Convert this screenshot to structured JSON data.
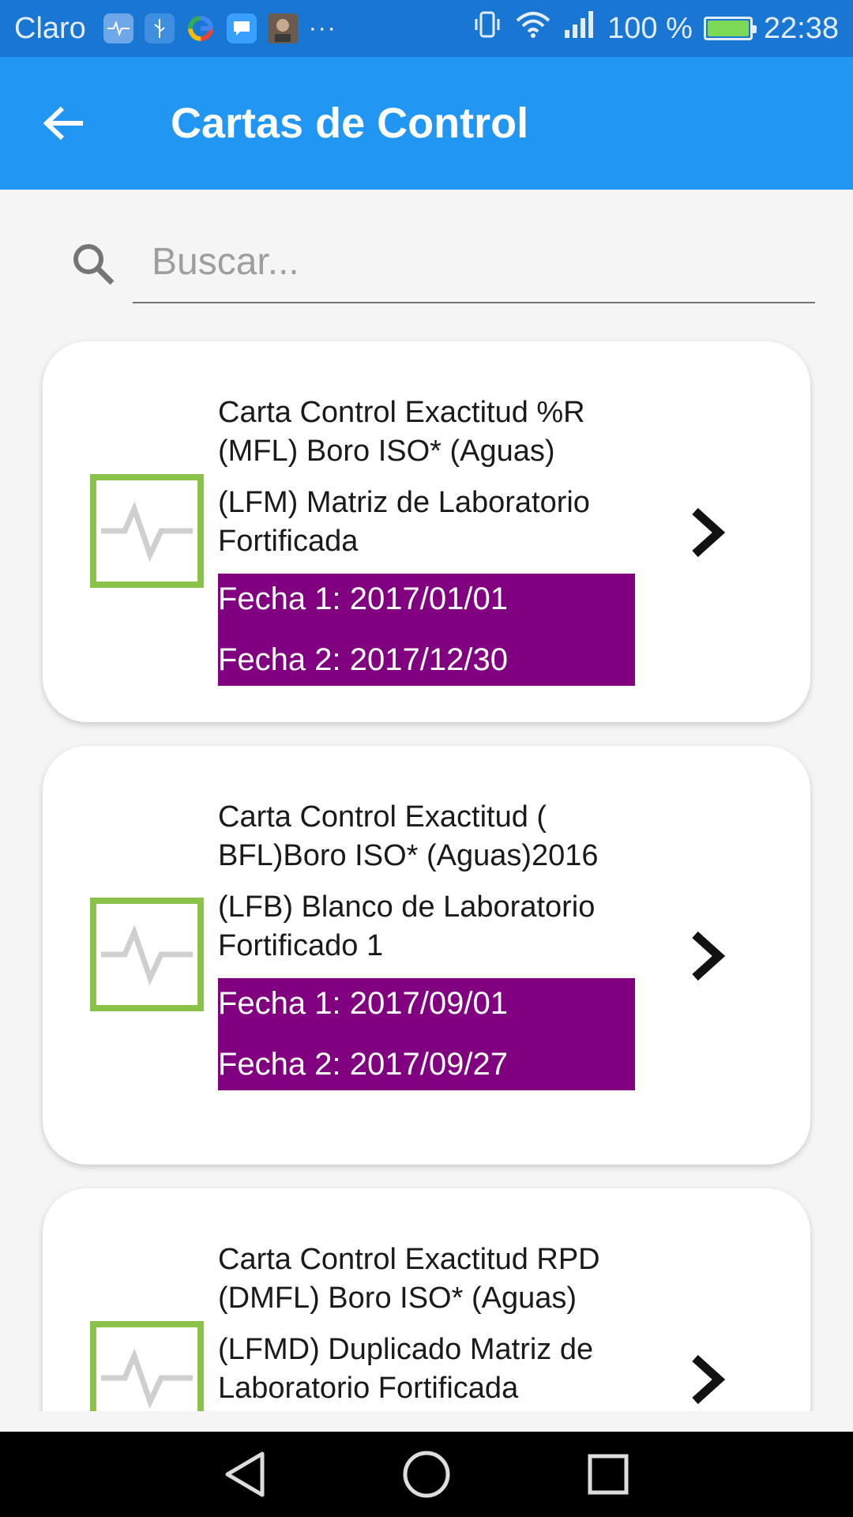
{
  "status_bar": {
    "carrier": "Claro",
    "more": "···",
    "battery_text": "100 %",
    "time": "22:38",
    "battery_level": 1.0,
    "icons": [
      "pulse-icon",
      "usb-icon",
      "google-icon",
      "chat-icon",
      "avatar-icon",
      "vibrate-icon",
      "wifi-icon",
      "signal-icon",
      "battery-icon"
    ]
  },
  "app_bar": {
    "title": "Cartas de Control",
    "back_icon": "arrow-left-icon"
  },
  "search": {
    "placeholder": "Buscar...",
    "value": "",
    "icon": "search-icon"
  },
  "cards": [
    {
      "title": "Carta Control Exactitud %R (MFL) Boro ISO* (Aguas)",
      "subtitle": "(LFM) Matriz de Laboratorio Fortificada",
      "date1": "Fecha 1: 2017/01/01",
      "date2": "Fecha 2: 2017/12/30"
    },
    {
      "title": "Carta Control Exactitud ( BFL)Boro ISO* (Aguas)2016",
      "subtitle": "(LFB) Blanco de Laboratorio Fortificado 1",
      "date1": "Fecha 1: 2017/09/01",
      "date2": "Fecha 2: 2017/09/27"
    },
    {
      "title": "Carta Control Exactitud RPD (DMFL) Boro ISO* (Aguas)",
      "subtitle": "(LFMD) Duplicado Matriz de Laboratorio Fortificada",
      "date1": "",
      "date2": ""
    }
  ],
  "colors": {
    "app_bar": "#2196f3",
    "status_bar": "#1976d2",
    "date_band": "#800080",
    "thumb_border": "#8bc34a"
  },
  "nav_bar": {
    "icons": [
      "back-triangle-icon",
      "home-circle-icon",
      "recents-square-icon"
    ]
  }
}
